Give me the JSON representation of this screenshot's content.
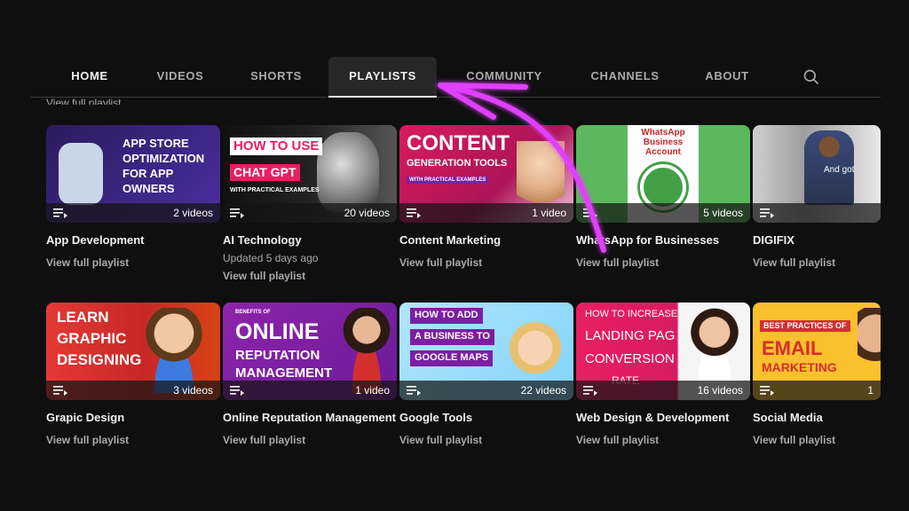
{
  "tabs": [
    {
      "label": "HOME"
    },
    {
      "label": "VIDEOS"
    },
    {
      "label": "SHORTS"
    },
    {
      "label": "PLAYLISTS"
    },
    {
      "label": "COMMUNITY"
    },
    {
      "label": "CHANNELS"
    },
    {
      "label": "ABOUT"
    }
  ],
  "clipped_text": "View full playlist",
  "view_full": "View full playlist",
  "colors": {
    "accent_arrow": "#e040fb",
    "bg": "#0f0f0f"
  },
  "playlists": [
    {
      "title": "App Development",
      "count": "2 videos",
      "thumb_lines": [
        "APP STORE",
        "OPTIMIZATION",
        "FOR APP",
        "OWNERS"
      ]
    },
    {
      "title": "AI Technology",
      "count": "20 videos",
      "updated": "Updated 5 days ago",
      "thumb_lines": [
        "HOW TO USE",
        "CHAT GPT",
        "WITH PRACTICAL EXAMPLES"
      ]
    },
    {
      "title": "Content Marketing",
      "count": "1 video",
      "thumb_lines": [
        "CONTENT",
        "GENERATION TOOLS",
        "WITH PRACTICAL EXAMPLES"
      ]
    },
    {
      "title": "WhatsApp for Businesses",
      "count": "5 videos",
      "thumb_lines": [
        "WhatsApp",
        "Business",
        "Account"
      ]
    },
    {
      "title": "DIGIFIX",
      "count": "",
      "thumb_lines": [
        "And got"
      ]
    },
    {
      "title": "Grapic Design",
      "count": "3 videos",
      "thumb_lines": [
        "LEARN",
        "GRAPHIC",
        "DESIGNING"
      ]
    },
    {
      "title": "Online Reputation Management",
      "count": "1 video",
      "thumb_lines": [
        "BENEFITS OF",
        "ONLINE",
        "REPUTATION",
        "MANAGEMENT"
      ]
    },
    {
      "title": "Google Tools",
      "count": "22 videos",
      "thumb_lines": [
        "HOW TO ADD",
        "A BUSINESS TO",
        "GOOGLE MAPS"
      ]
    },
    {
      "title": "Web Design & Development",
      "count": "16 videos",
      "thumb_lines": [
        "HOW TO INCREASE",
        "LANDING PAG",
        "CONVERSION",
        "RATE"
      ]
    },
    {
      "title": "Social Media",
      "count": "1",
      "thumb_lines": [
        "BEST PRACTICES OF",
        "EMAIL",
        "MARKETING"
      ]
    }
  ]
}
